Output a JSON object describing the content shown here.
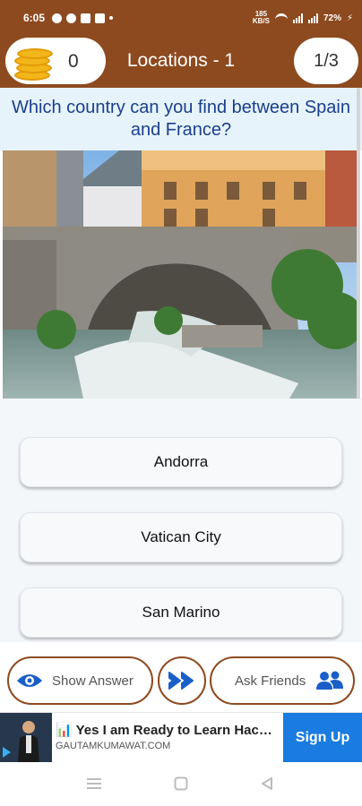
{
  "status_bar": {
    "time": "6:05",
    "net_speed_top": "185",
    "net_speed_bottom": "KB/S",
    "battery": "72%"
  },
  "header": {
    "coins": "0",
    "title": "Locations - 1",
    "progress": "1/3"
  },
  "question": {
    "text": "Which country can you find between Spain and France?"
  },
  "answers": [
    {
      "label": "Andorra"
    },
    {
      "label": "Vatican City"
    },
    {
      "label": "San Marino"
    }
  ],
  "actions": {
    "show_answer": "Show Answer",
    "ask_friends": "Ask Friends"
  },
  "ad": {
    "title": "Yes I am Ready to Learn Hacking",
    "domain": "GAUTAMKUMAWAT.COM",
    "cta": "Sign Up"
  },
  "colors": {
    "header_brown": "#8d4a1f",
    "question_blue": "#1a3f8c",
    "accent_blue": "#1a5fc8"
  },
  "icons": {
    "eye": "eye-icon",
    "skip": "skip-icon",
    "friends": "friends-icon",
    "coins": "coin-stack-icon"
  }
}
